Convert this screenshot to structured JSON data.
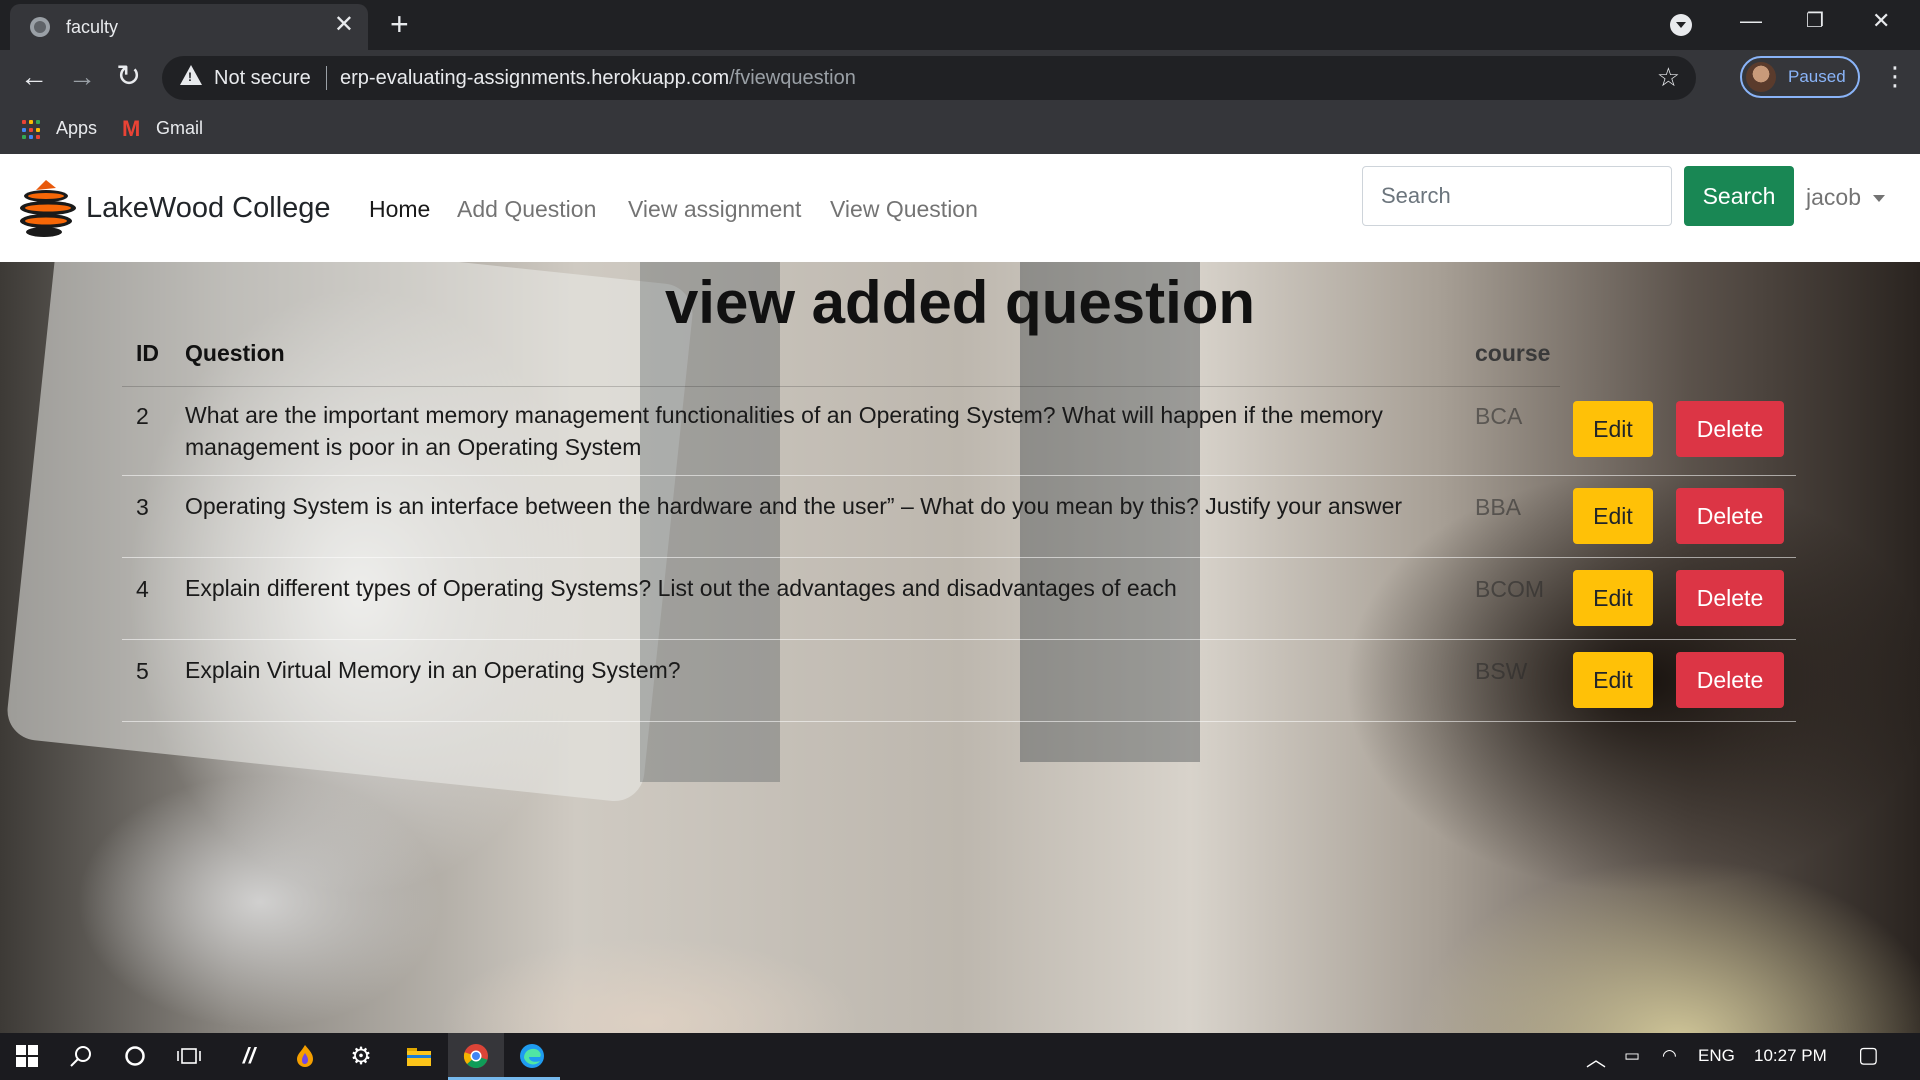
{
  "browser": {
    "tab_title": "faculty",
    "url_security": "Not secure",
    "url_host": "erp-evaluating-assignments.herokuapp.com",
    "url_path": "/fviewquestion",
    "profile_status": "Paused",
    "bookmarks": [
      {
        "label": "Apps",
        "icon": "apps-grid-icon"
      },
      {
        "label": "Gmail",
        "icon": "gmail-icon"
      }
    ]
  },
  "navbar": {
    "brand": "LakeWood College",
    "links": [
      {
        "label": "Home",
        "active": true
      },
      {
        "label": "Add Question",
        "active": false
      },
      {
        "label": "View assignment",
        "active": false
      },
      {
        "label": "View Question",
        "active": false
      }
    ],
    "search_placeholder": "Search",
    "search_button": "Search",
    "user": "jacob"
  },
  "main": {
    "title": "view added question",
    "columns": {
      "id": "ID",
      "question": "Question",
      "course": "course"
    },
    "rows": [
      {
        "id": "2",
        "question": "What are the important memory management functionalities of an Operating System? What will happen if the memory management is poor in an Operating System",
        "course": "BCA",
        "edit": "Edit",
        "delete": "Delete"
      },
      {
        "id": "3",
        "question": "Operating System is an interface between the hardware and the user” – What do you mean by this? Justify your answer",
        "course": "BBA",
        "edit": "Edit",
        "delete": "Delete"
      },
      {
        "id": "4",
        "question": "Explain different types of Operating Systems? List out the advantages and disadvantages of each",
        "course": "BCOM",
        "edit": "Edit",
        "delete": "Delete"
      },
      {
        "id": "5",
        "question": "Explain Virtual Memory in an Operating System?",
        "course": "BSW",
        "edit": "Edit",
        "delete": "Delete"
      }
    ]
  },
  "taskbar": {
    "language": "ENG",
    "time": "10:27 PM"
  },
  "colors": {
    "success": "#198754",
    "warning": "#ffc107",
    "danger": "#dc3545",
    "chrome_dark": "#202124"
  }
}
